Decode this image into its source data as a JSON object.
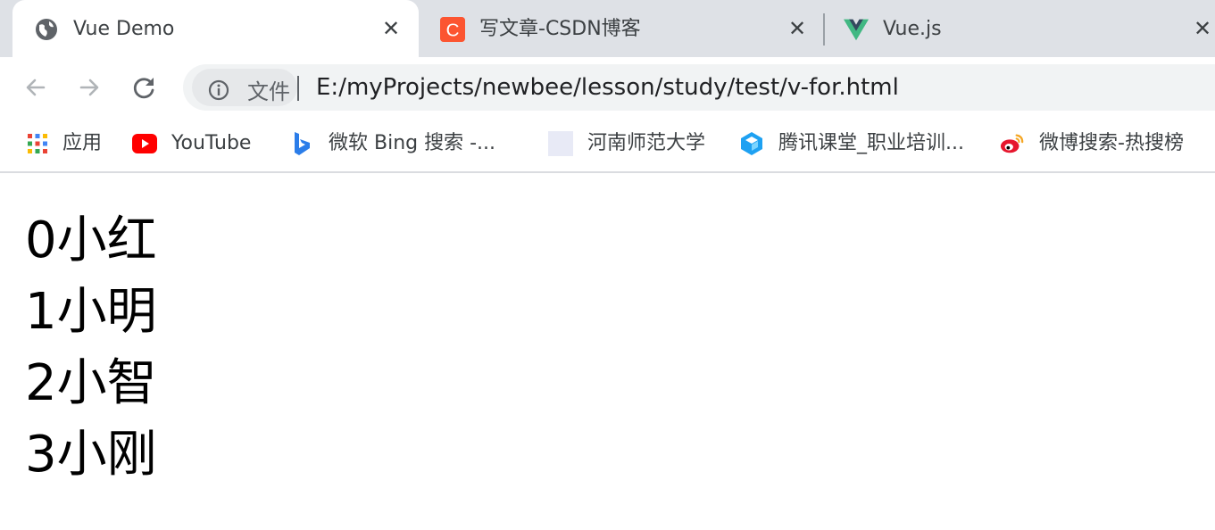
{
  "browser": {
    "tabs": [
      {
        "title": "Vue Demo",
        "icon": "globe-icon",
        "active": true
      },
      {
        "title": "写文章-CSDN博客",
        "icon": "csdn-icon",
        "icon_letter": "C",
        "icon_color": "#fc5531",
        "active": false
      },
      {
        "title": "Vue.js",
        "icon": "vue-logo-icon",
        "icon_color": "#41b883",
        "active": false
      }
    ],
    "tab_close_glyph": "✕",
    "address": {
      "security_label": "文件",
      "url": "E:/myProjects/newbee/lesson/study/test/v-for.html"
    },
    "bookmarks": [
      {
        "label": "应用",
        "icon": "apps-grid-icon"
      },
      {
        "label": "YouTube",
        "icon": "youtube-icon",
        "icon_color": "#ff0000"
      },
      {
        "label": "微软 Bing 搜索 -...",
        "icon": "bing-icon",
        "icon_color": "#2b7de9"
      },
      {
        "label": "河南师范大学",
        "icon": "blank-page-icon"
      },
      {
        "label": "腾讯课堂_职业培训...",
        "icon": "tencent-classroom-icon",
        "icon_color": "#1ea1f2"
      },
      {
        "label": "微博搜索-热搜榜",
        "icon": "weibo-icon",
        "icon_color": "#e6162d"
      }
    ]
  },
  "page": {
    "items": [
      "0小红",
      "1小明",
      "2小智",
      "3小刚"
    ]
  }
}
